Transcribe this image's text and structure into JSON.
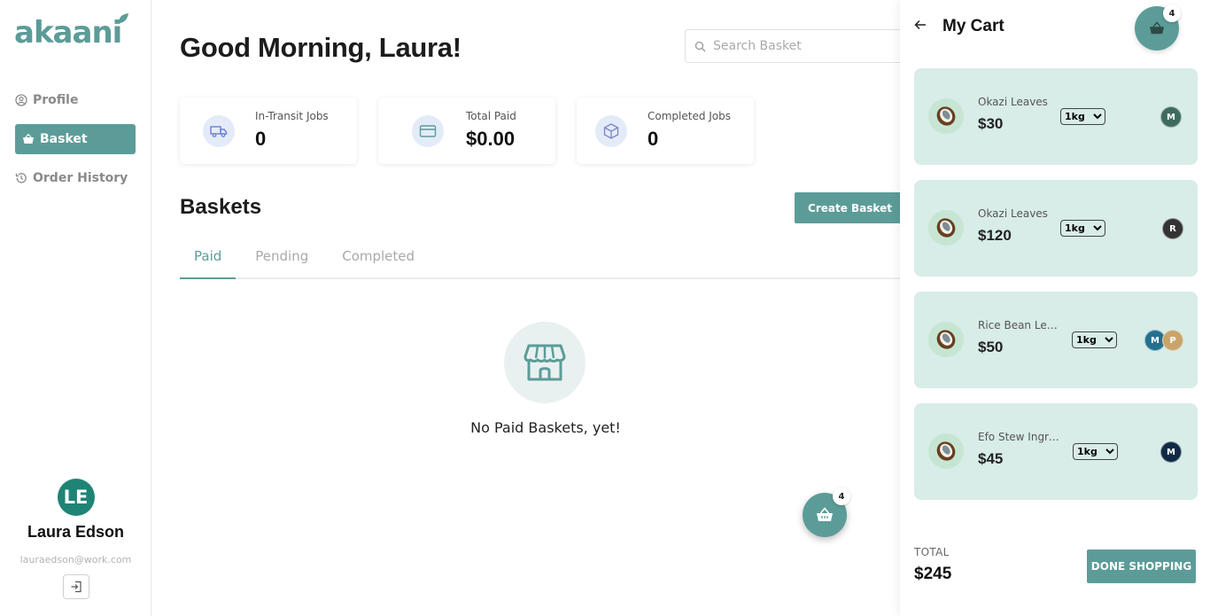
{
  "brand": {
    "logo_text": "akaani",
    "accent": "#5c9c98"
  },
  "sidebar": {
    "items": [
      {
        "label": "Profile",
        "icon": "user-circle-icon",
        "active": false
      },
      {
        "label": "Basket",
        "icon": "basket-icon",
        "active": true
      },
      {
        "label": "Order History",
        "icon": "history-icon",
        "active": false
      }
    ],
    "user": {
      "initials": "LE",
      "name": "Laura Edson",
      "email": "lauraedson@work.com"
    }
  },
  "header": {
    "greeting": "Good Morning, Laura!",
    "search_placeholder": "Search Basket"
  },
  "stats": [
    {
      "label": "In-Transit Jobs",
      "value": "0",
      "icon": "truck-icon"
    },
    {
      "label": "Total Paid",
      "value": "$0.00",
      "icon": "card-icon"
    },
    {
      "label": "Completed Jobs",
      "value": "0",
      "icon": "box-icon"
    }
  ],
  "baskets": {
    "title": "Baskets",
    "create_label": "Create Basket",
    "tabs": [
      {
        "label": "Paid",
        "active": true
      },
      {
        "label": "Pending",
        "active": false
      },
      {
        "label": "Completed",
        "active": false
      }
    ],
    "empty_text": "No Paid Baskets, yet!",
    "empty_icon": "storefront-icon"
  },
  "floating_cart": {
    "count": "4",
    "icon": "basket-icon"
  },
  "cart": {
    "title": "My Cart",
    "count": "4",
    "items": [
      {
        "name": "Okazi Leaves",
        "price": "$30",
        "weight": "1kg",
        "chips": [
          {
            "letter": "M",
            "color": "#3e6b5f"
          }
        ]
      },
      {
        "name": "Okazi Leaves",
        "price": "$120",
        "weight": "1kg",
        "chips": [
          {
            "letter": "R",
            "color": "#333333"
          }
        ]
      },
      {
        "name": "Rice Bean Lea...",
        "price": "$50",
        "weight": "1kg",
        "chips": [
          {
            "letter": "M",
            "color": "#23708f"
          },
          {
            "letter": "P",
            "color": "#c9a46a"
          }
        ]
      },
      {
        "name": "Efo Stew Ingre...",
        "price": "$45",
        "weight": "1kg",
        "chips": [
          {
            "letter": "M",
            "color": "#0f2a44"
          }
        ]
      }
    ],
    "total_label": "TOTAL",
    "total_value": "$245",
    "done_label": "DONE SHOPPING"
  }
}
